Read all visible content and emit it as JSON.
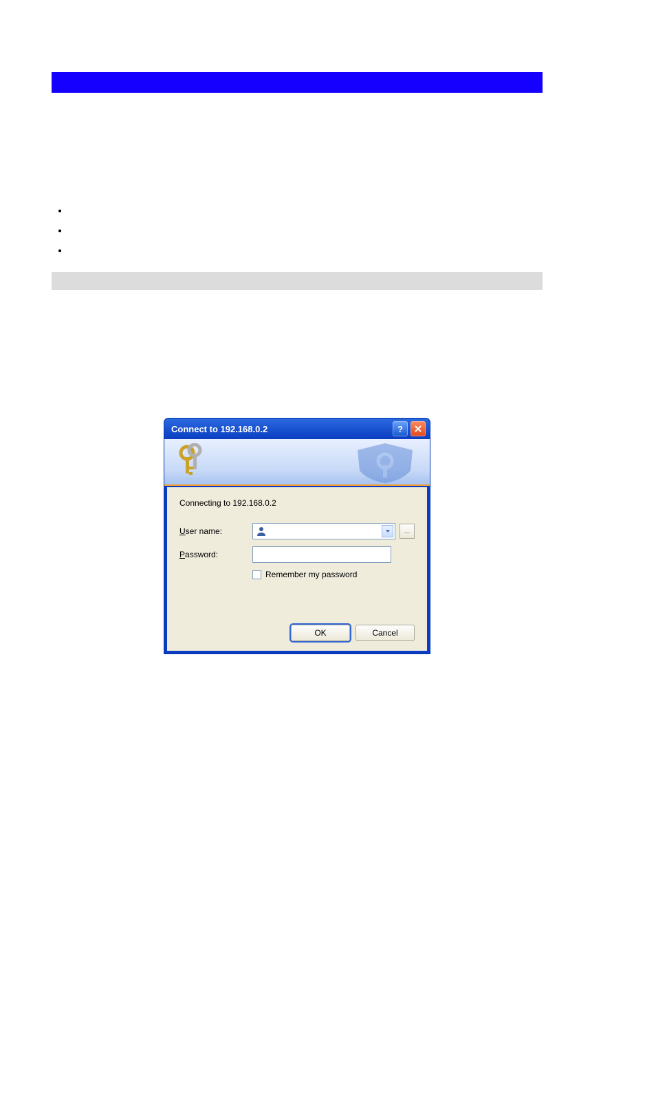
{
  "dialog": {
    "title": "Connect to 192.168.0.2",
    "status": "Connecting to 192.168.0.2",
    "username_label_pre": "U",
    "username_label_post": "ser name:",
    "password_label_pre": "P",
    "password_label_post": "assword:",
    "username_value": "",
    "password_value": "",
    "remember_pre": "R",
    "remember_post": "emember my password",
    "ok_label": "OK",
    "cancel_label": "Cancel"
  }
}
